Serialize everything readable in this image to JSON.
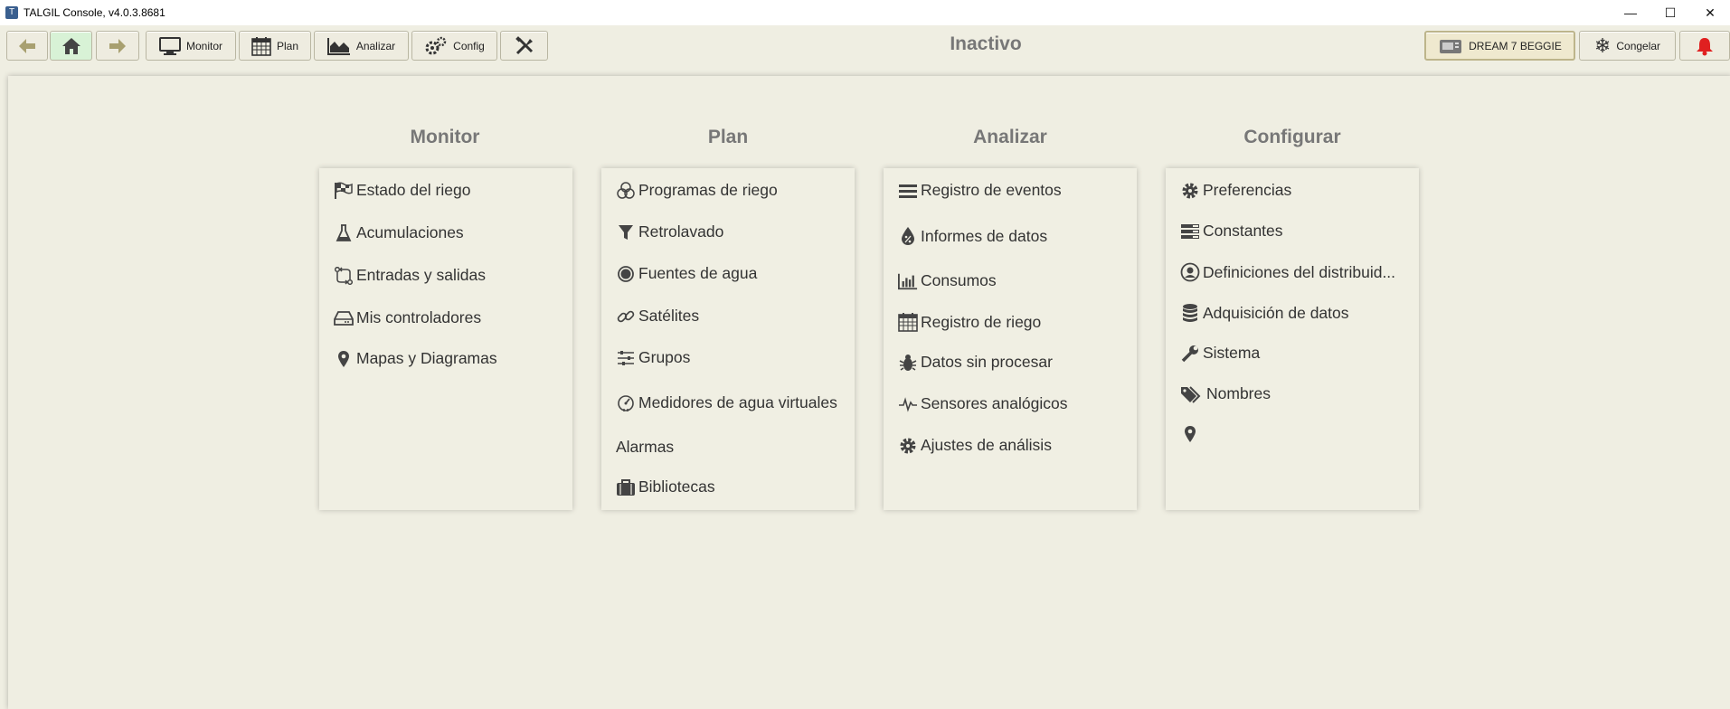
{
  "window": {
    "title": "TALGIL Console, v4.0.3.8681",
    "app_icon": "T"
  },
  "toolbar": {
    "monitor_label": "Monitor",
    "plan_label": "Plan",
    "analyze_label": "Analizar",
    "config_label": "Config",
    "device_label": "DREAM 7 BEGGIE",
    "freeze_label": "Congelar",
    "status": "Inactivo",
    "accent_home": "#d8f2d6",
    "alarm_color": "#e02020"
  },
  "columns": {
    "monitor": {
      "title": "Monitor",
      "items": [
        "Estado del riego",
        "Acumulaciones",
        "Entradas y salidas",
        "Mis controladores",
        "Mapas y Diagramas"
      ]
    },
    "plan": {
      "title": "Plan",
      "items": [
        "Programas de riego",
        "Retrolavado",
        "Fuentes de agua",
        "Satélites",
        "Grupos",
        "Medidores de agua virtuales",
        "Alarmas",
        "Bibliotecas"
      ]
    },
    "analyze": {
      "title": "Analizar",
      "items": [
        "Registro de eventos",
        "Informes de datos",
        "Consumos",
        "Registro de riego",
        "Datos sin procesar",
        "Sensores analógicos",
        "Ajustes de análisis"
      ]
    },
    "config": {
      "title": "Configurar",
      "items": [
        "Preferencias",
        "Constantes",
        "Definiciones del distribuid...",
        "Adquisición de datos",
        "Sistema",
        "Nombres",
        ""
      ]
    }
  }
}
